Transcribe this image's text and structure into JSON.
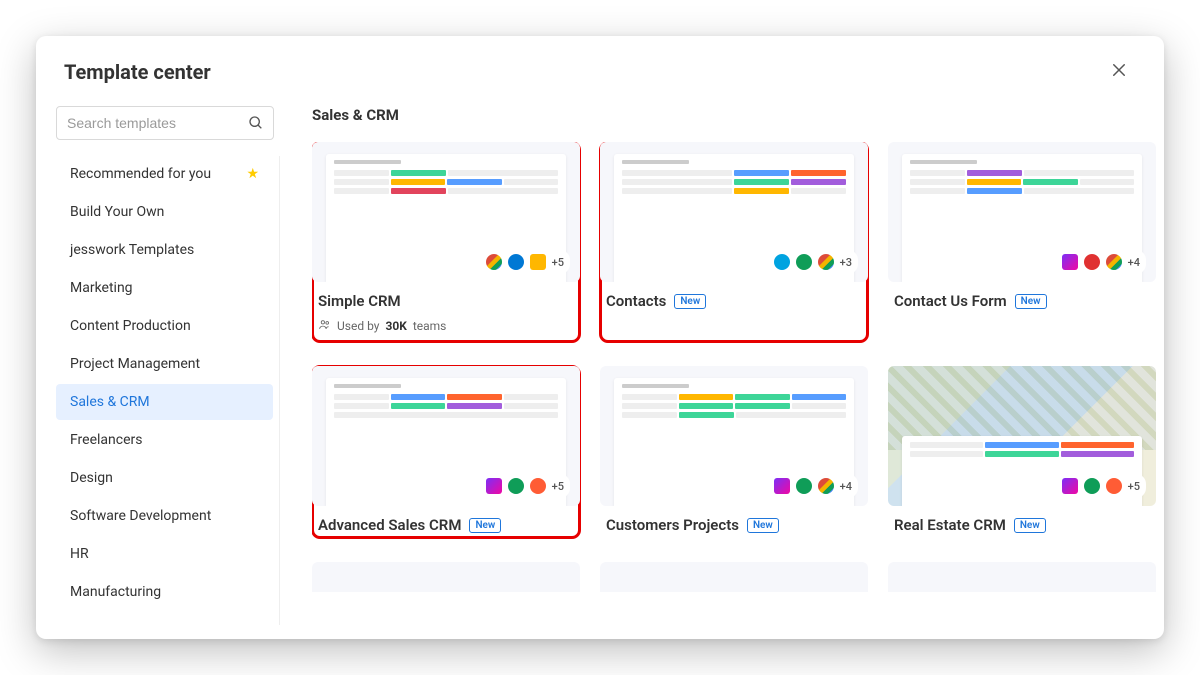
{
  "header": {
    "title": "Template center"
  },
  "search": {
    "placeholder": "Search templates"
  },
  "sidebar": {
    "items": [
      {
        "label": "Recommended for you",
        "starred": true
      },
      {
        "label": "Build Your Own"
      },
      {
        "label": "jesswork Templates"
      },
      {
        "label": "Marketing"
      },
      {
        "label": "Content Production"
      },
      {
        "label": "Project Management"
      },
      {
        "label": "Sales & CRM",
        "active": true
      },
      {
        "label": "Freelancers"
      },
      {
        "label": "Design"
      },
      {
        "label": "Software Development"
      },
      {
        "label": "HR"
      },
      {
        "label": "Manufacturing"
      }
    ]
  },
  "section": {
    "title": "Sales & CRM"
  },
  "cards": [
    {
      "title": "Simple CRM",
      "highlight": true,
      "plus": "+5",
      "icons": [
        "gm",
        "bl",
        "yl"
      ],
      "used_prefix": "Used by",
      "used_count": "30K",
      "used_suffix": "teams"
    },
    {
      "title": "Contacts",
      "highlight": true,
      "new": "New",
      "plus": "+3",
      "icons": [
        "az",
        "gr",
        "gm"
      ]
    },
    {
      "title": "Contact Us Form",
      "new": "New",
      "plus": "+4",
      "icons": [
        "pu",
        "rd",
        "gm"
      ]
    },
    {
      "title": "Advanced Sales CRM",
      "highlight": true,
      "new": "New",
      "plus": "+5",
      "icons": [
        "pu",
        "gr",
        "or"
      ]
    },
    {
      "title": "Customers Projects",
      "new": "New",
      "plus": "+4",
      "icons": [
        "pu",
        "gr",
        "gm"
      ]
    },
    {
      "title": "Real Estate CRM",
      "new": "New",
      "plus": "+5",
      "icons": [
        "pu",
        "gr",
        "or"
      ],
      "map": true
    }
  ]
}
